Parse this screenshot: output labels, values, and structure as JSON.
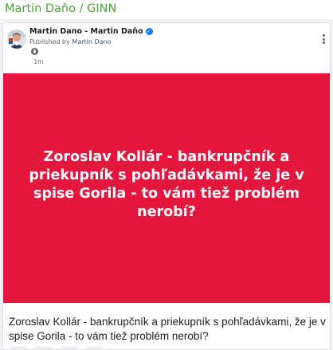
{
  "header": {
    "source": "Martin Daňo / GINN"
  },
  "post": {
    "page_name": "Martin Dano - Martin Daňo",
    "published_prefix": "Published by",
    "published_by": "Martin Dano",
    "time": "1m",
    "time_separator": "·",
    "image_text": "Zoroslav Kollár - bankrupčník a priekupník s pohľadávkami, že je v spise Gorila - to vám tiež problém nerobí?",
    "caption": "Zoroslav Kollár - bankrupčník a priekupník s pohľadávkami, že je v spise Gorila - to vám tiež problém nerobí?"
  },
  "colors": {
    "brand_green": "#4aa43a",
    "panel_red": "#e3173e",
    "verified_blue": "#1877f2",
    "link_blue": "#385898"
  },
  "icons": {
    "verified": "verified-badge-icon",
    "audience": "world-icon",
    "menu": "more-options-icon"
  }
}
